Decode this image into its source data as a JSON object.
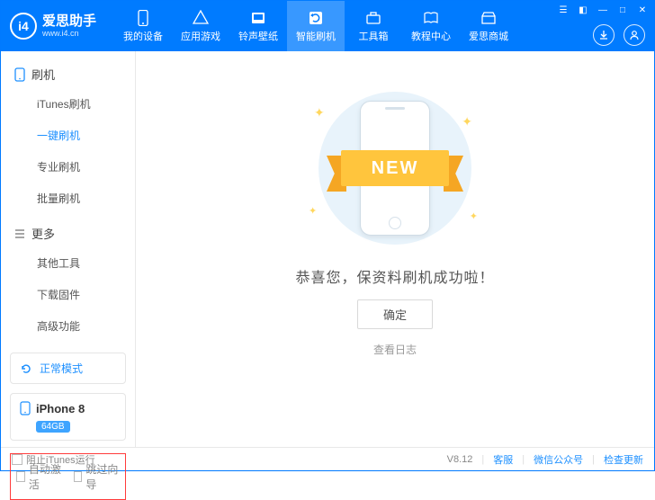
{
  "brand": {
    "cn": "爱思助手",
    "en": "www.i4.cn",
    "logo": "i4"
  },
  "topnav": [
    {
      "label": "我的设备",
      "icon": "device"
    },
    {
      "label": "应用游戏",
      "icon": "apps"
    },
    {
      "label": "铃声壁纸",
      "icon": "music"
    },
    {
      "label": "智能刷机",
      "icon": "flash",
      "active": true
    },
    {
      "label": "工具箱",
      "icon": "toolbox"
    },
    {
      "label": "教程中心",
      "icon": "book"
    },
    {
      "label": "爱思商城",
      "icon": "store"
    }
  ],
  "sidebar": {
    "groups": [
      {
        "title": "刷机",
        "items": [
          {
            "label": "iTunes刷机"
          },
          {
            "label": "一键刷机",
            "active": true
          },
          {
            "label": "专业刷机"
          },
          {
            "label": "批量刷机"
          }
        ]
      },
      {
        "title": "更多",
        "items": [
          {
            "label": "其他工具"
          },
          {
            "label": "下载固件"
          },
          {
            "label": "高级功能"
          }
        ]
      }
    ],
    "mode_label": "正常模式",
    "device": {
      "name": "iPhone 8",
      "capacity": "64GB"
    },
    "checks": {
      "auto_activate": "自动激活",
      "skip_guide": "跳过向导"
    }
  },
  "main": {
    "ribbon": "NEW",
    "success": "恭喜您，保资料刷机成功啦！",
    "ok": "确定",
    "log": "查看日志"
  },
  "footer": {
    "block_itunes": "阻止iTunes运行",
    "version": "V8.12",
    "support": "客服",
    "wechat": "微信公众号",
    "update": "检查更新"
  }
}
